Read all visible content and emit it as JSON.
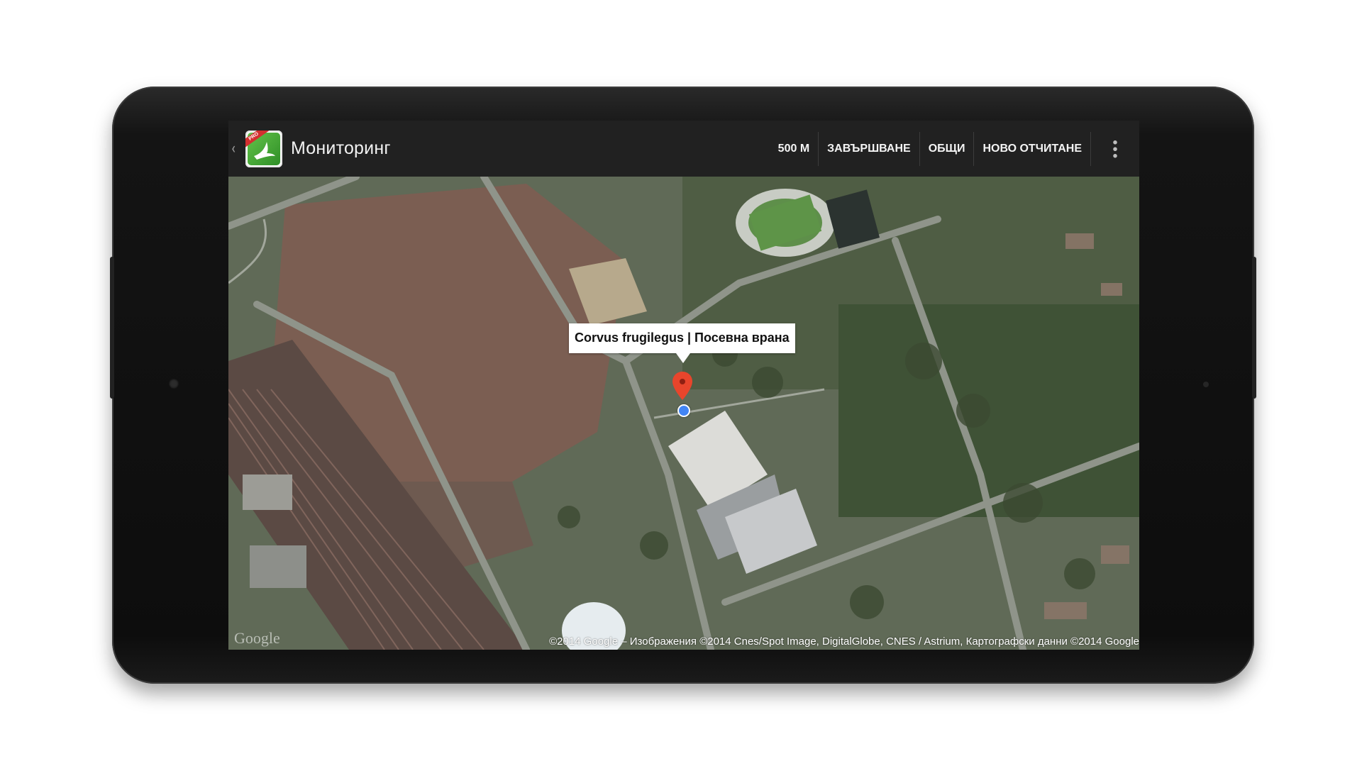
{
  "app": {
    "title": "Мониторинг",
    "up_glyph": "‹",
    "icon_badge": "PRO"
  },
  "actions": [
    {
      "label": "500 М"
    },
    {
      "label": "ЗАВЪРШВАНЕ"
    },
    {
      "label": "ОБЩИ"
    },
    {
      "label": "НОВО ОТЧИТАНЕ"
    }
  ],
  "map": {
    "marker_label": "Corvus frugilegus | Посевна врана",
    "logo_text": "Google",
    "attribution": "©2014 Google – Изображения ©2014 Cnes/Spot Image, DigitalGlobe, CNES / Astrium, Картографски данни ©2014 Google",
    "colors": {
      "marker": "#e8452c",
      "location_dot": "#4285f4",
      "action_bar": "#212121"
    }
  }
}
